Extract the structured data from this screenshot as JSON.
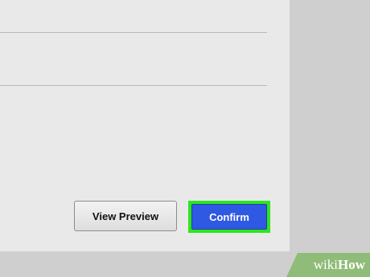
{
  "dialog": {
    "buttons": {
      "preview_label": "View Preview",
      "confirm_label": "Confirm"
    }
  },
  "watermark": {
    "text_wiki": "wiki",
    "text_how": "How"
  },
  "colors": {
    "confirm_button": "#2f58e3",
    "highlight": "#2ee51e",
    "panel": "#e9e9e9",
    "background": "#cfcfcf"
  }
}
